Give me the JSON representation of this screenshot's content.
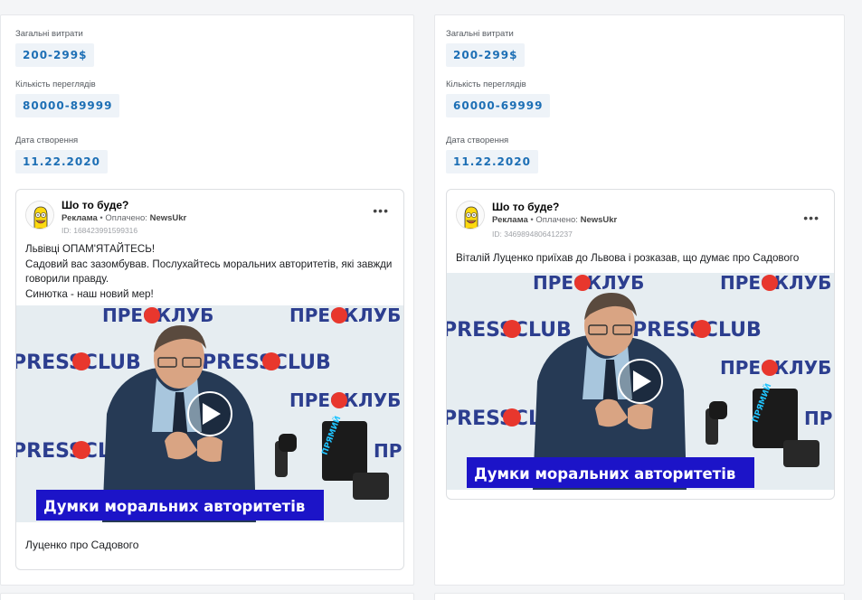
{
  "cards": [
    {
      "stats": {
        "spend_label": "Загальні витрати",
        "spend_value": "200-299$",
        "views_label": "Кількість переглядів",
        "views_value": "80000-89999",
        "date_label": "Дата створення",
        "date_value": "11.22.2020"
      },
      "ad": {
        "page_name": "Шо то буде?",
        "sponsored": "Реклама",
        "paid_by_prefix": "• Оплачено:",
        "paid_by": "NewsUkr",
        "ad_id": "ID: 168423991599316",
        "text_lines": [
          "Львівці ОПАМ'ЯТАЙТЕСЬ!",
          "Садовий вас зазомбував. Послухайтесь моральних авторитетів, які завжди говорили правду.",
          "Синютка - наш новий мер!"
        ],
        "video_banner": "Думки моральних авторитетів",
        "press_logo_top": "ПРЕСКЛУБ",
        "press_logo_latin": "PRESSCLUB",
        "mic_label": "ПРЯМИЙ",
        "caption": "Луценко про Садового"
      }
    },
    {
      "stats": {
        "spend_label": "Загальні витрати",
        "spend_value": "200-299$",
        "views_label": "Кількість переглядів",
        "views_value": "60000-69999",
        "date_label": "Дата створення",
        "date_value": "11.22.2020"
      },
      "ad": {
        "page_name": "Шо то буде?",
        "sponsored": "Реклама",
        "paid_by_prefix": "• Оплачено:",
        "paid_by": "NewsUkr",
        "ad_id": "ID: 3469894806412237",
        "text_lines": [
          "Віталій Луценко приїхав до Львова і розказав, що думає про Садового"
        ],
        "video_banner": "Думки моральних авторитетів",
        "press_logo_top": "ПРЕСКЛУБ",
        "press_logo_latin": "PRESSCLUB",
        "mic_label": "ПРЯМИЙ",
        "caption": ""
      }
    }
  ],
  "icons": {
    "more": "more-horizontal-icon",
    "play": "play-icon",
    "avatar": "homer-avatar-icon"
  },
  "colors": {
    "stat_value": "#1d6fb5",
    "stat_bg": "#eef3f8",
    "banner_bg": "#1c14c8",
    "press_red": "#e8372d",
    "press_blue": "#2c3e8f"
  }
}
